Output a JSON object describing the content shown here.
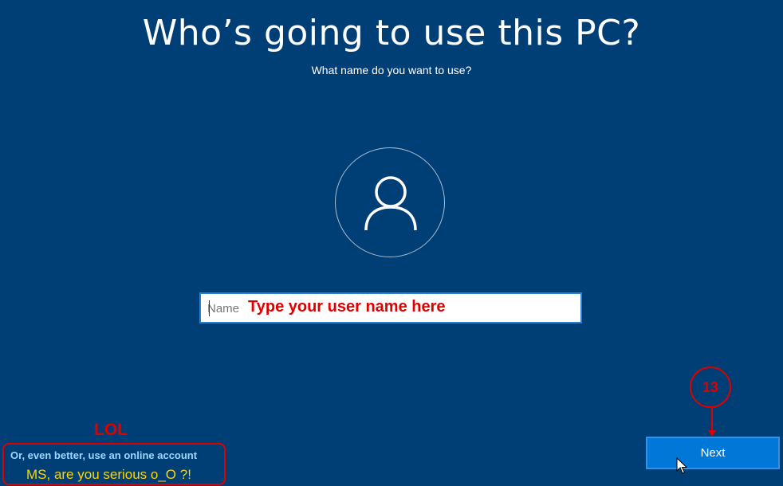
{
  "page": {
    "title": "Who’s going to use this PC?",
    "subtitle": "What name do you want to use?"
  },
  "avatar": {
    "icon": "user-icon"
  },
  "name_input": {
    "placeholder": "Name",
    "value": ""
  },
  "online_account": {
    "label": "Or, even better, use an online account"
  },
  "buttons": {
    "next_label": "Next"
  },
  "annotations": {
    "type_hint": "Type your user name here",
    "lol": "LOL",
    "ms_comment": "MS, are you serious o_O ?!",
    "step_number": "13"
  },
  "colors": {
    "background": "#003f76",
    "accent": "#0078d7",
    "annotation_red": "#e00000",
    "annotation_yellow": "#ffd400",
    "link": "#9fd4ff"
  }
}
